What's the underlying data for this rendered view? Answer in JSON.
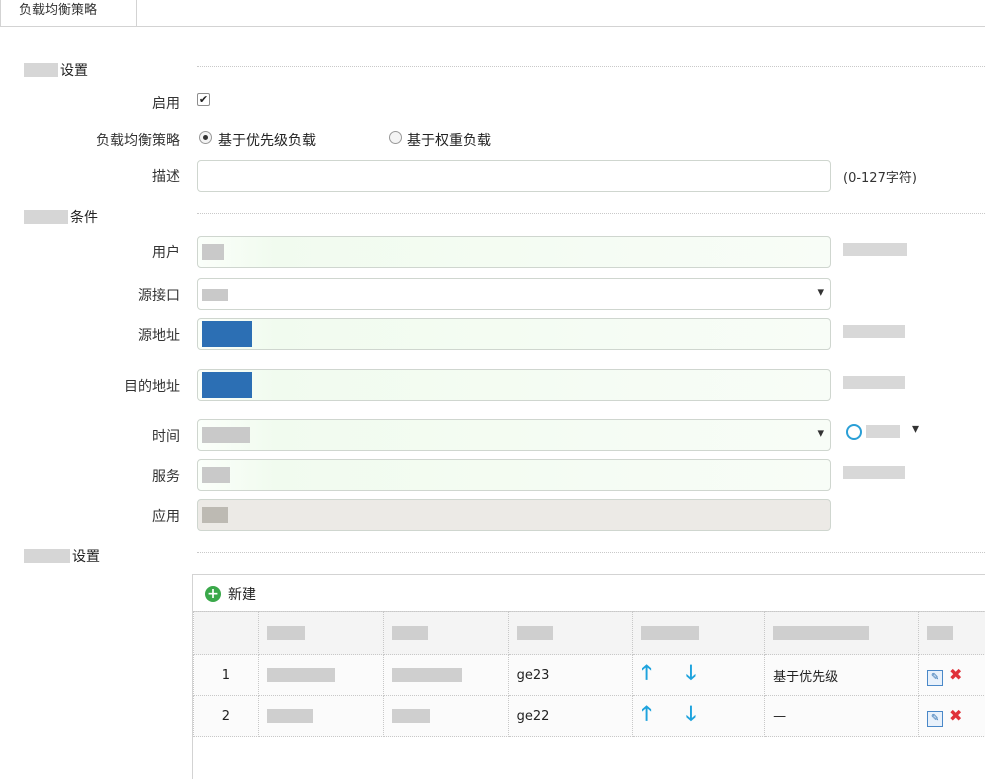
{
  "tab": {
    "label": "负载均衡策略"
  },
  "sections": {
    "basic": "设置",
    "match": "条件",
    "route": "设置"
  },
  "form": {
    "enable_label": "启用",
    "enable_checked": "✔",
    "strategy_label": "负载均衡策略",
    "strategy_options": [
      "基于优先级负载",
      "基于权重负载"
    ],
    "strategy_selected": "基于优先级负载",
    "desc_label": "描述",
    "desc_value": "",
    "desc_hint": "(0-127字符)",
    "user_label": "用户",
    "src_if_label": "源接口",
    "src_addr_label": "源地址",
    "dst_addr_label": "目的地址",
    "time_label": "时间",
    "service_label": "服务",
    "app_label": "应用"
  },
  "grid": {
    "add_label": "新建",
    "rows": [
      {
        "index": "1",
        "iface": "ge23",
        "strategy": "基于优先级"
      },
      {
        "index": "2",
        "iface": "ge22",
        "strategy": "—"
      }
    ]
  },
  "icons": [
    "checkbox-icon",
    "radio-icon",
    "clock-icon",
    "add-icon",
    "arrow-up-icon",
    "arrow-down-icon",
    "edit-icon",
    "delete-icon"
  ],
  "colors": {
    "accent": "#1ea3dd",
    "selected_chip": "#2c6fb4",
    "add": "#3aa84a",
    "delete": "#e0323a"
  }
}
